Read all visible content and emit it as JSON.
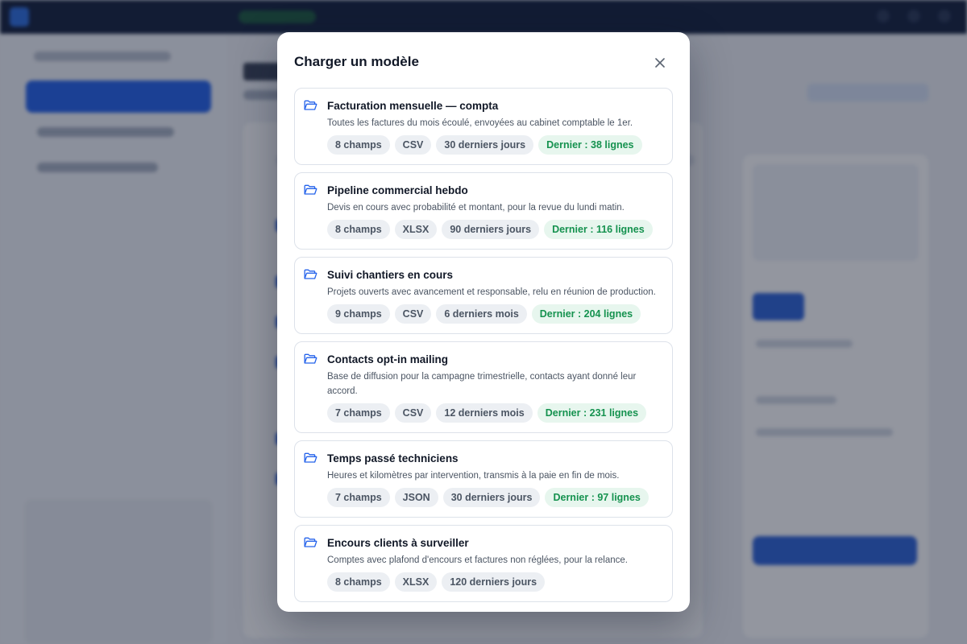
{
  "colors": {
    "accent": "#2563eb",
    "success_text": "#15924f",
    "success_bg": "#e7f6ee",
    "overlay": "rgba(15,23,42,0.45)"
  },
  "modal": {
    "title": "Charger un modèle",
    "close_icon": "close-icon",
    "item_icon": "folder-open-icon",
    "templates": [
      {
        "title": "Facturation mensuelle — compta",
        "description": "Toutes les factures du mois écoulé, envoyées au cabinet comptable le 1er.",
        "fields": "8 champs",
        "format": "CSV",
        "period": "30 derniers jours",
        "last": "Dernier : 38 lignes"
      },
      {
        "title": "Pipeline commercial hebdo",
        "description": "Devis en cours avec probabilité et montant, pour la revue du lundi matin.",
        "fields": "8 champs",
        "format": "XLSX",
        "period": "90 derniers jours",
        "last": "Dernier : 116 lignes"
      },
      {
        "title": "Suivi chantiers en cours",
        "description": "Projets ouverts avec avancement et responsable, relu en réunion de production.",
        "fields": "9 champs",
        "format": "CSV",
        "period": "6 derniers mois",
        "last": "Dernier : 204 lignes"
      },
      {
        "title": "Contacts opt-in mailing",
        "description": "Base de diffusion pour la campagne trimestrielle, contacts ayant donné leur accord.",
        "fields": "7 champs",
        "format": "CSV",
        "period": "12 derniers mois",
        "last": "Dernier : 231 lignes"
      },
      {
        "title": "Temps passé techniciens",
        "description": "Heures et kilomètres par intervention, transmis à la paie en fin de mois.",
        "fields": "7 champs",
        "format": "JSON",
        "period": "30 derniers jours",
        "last": "Dernier : 97 lignes"
      },
      {
        "title": "Encours clients à surveiller",
        "description": "Comptes avec plafond d'encours et factures non réglées, pour la relance.",
        "fields": "8 champs",
        "format": "XLSX",
        "period": "120 derniers jours",
        "last": null
      }
    ]
  }
}
